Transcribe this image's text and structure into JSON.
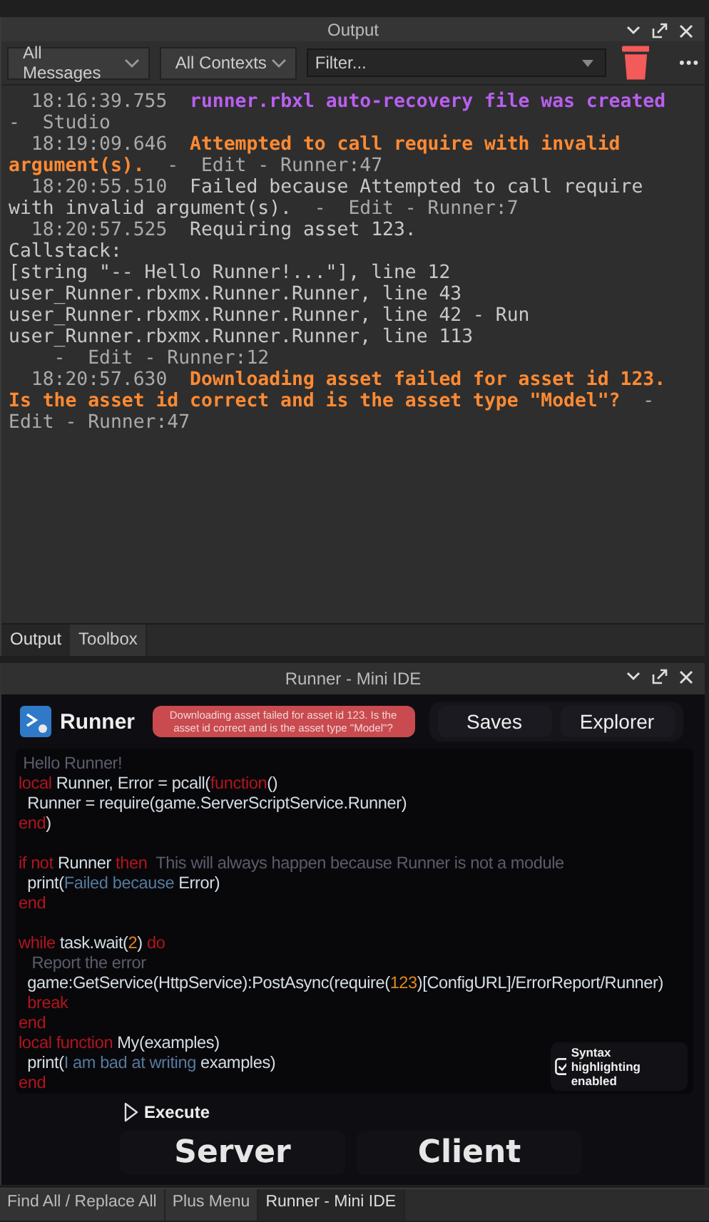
{
  "output_panel": {
    "title": "Output",
    "filters": [
      {
        "label": "All Messages"
      },
      {
        "label": "All Contexts"
      }
    ],
    "filter_field": {
      "placeholder": "Filter..."
    },
    "entries": [
      {
        "time": "18:16:39.755",
        "kind": "info",
        "message": "runner.rbxl auto-recovery file was created",
        "source": "-  Studio"
      },
      {
        "time": "18:19:09.646",
        "kind": "warning",
        "message": "Attempted to call require with invalid argument(s).",
        "source": "-  Edit - Runner:47"
      },
      {
        "time": "18:20:55.510",
        "kind": "plain",
        "message": "Failed because Attempted to call require with invalid argument(s).",
        "source": "-  Edit - Runner:7"
      },
      {
        "time": "18:20:57.525",
        "kind": "plain",
        "message": "Requiring asset 123.\nCallstack:\n[string \"-- Hello Runner!...\"], line 12\nuser_Runner.rbxmx.Runner.Runner, line 43\nuser_Runner.rbxmx.Runner.Runner, line 42 - Run\nuser_Runner.rbxmx.Runner.Runner, line 113\n",
        "source": "  -  Edit - Runner:12"
      },
      {
        "time": "18:20:57.630",
        "kind": "warning",
        "message": "Downloading asset failed for asset id 123. Is the asset id correct and is the asset type \"Model\"?",
        "source": "-  Edit - Runner:47"
      }
    ],
    "tabs": [
      {
        "label": "Output",
        "selected": true
      },
      {
        "label": "Toolbox",
        "selected": false
      }
    ]
  },
  "ide_panel": {
    "title": "Runner - Mini IDE",
    "app_name": "Runner",
    "error_badge": "Downloading asset failed for asset id 123.  Is the asset id correct and is the asset type \"Model\"?",
    "header_buttons": [
      {
        "label": "Saves"
      },
      {
        "label": "Explorer"
      }
    ],
    "code_lines": [
      {
        "kind": "code",
        "tokens": [
          {
            "t": " Hello Runner!",
            "kind": "comment"
          }
        ]
      },
      {
        "kind": "code",
        "tokens": [
          {
            "t": "local ",
            "kind": "keyword"
          },
          {
            "t": "Runner, Error = pcall(",
            "kind": "text"
          },
          {
            "t": "function",
            "kind": "keyword"
          },
          {
            "t": "()",
            "kind": "text"
          }
        ]
      },
      {
        "kind": "code",
        "tokens": [
          {
            "t": "  Runner = require(game.ServerScriptService.Runner)",
            "kind": "text"
          }
        ]
      },
      {
        "kind": "code",
        "tokens": [
          {
            "t": "end",
            "kind": "keyword"
          },
          {
            "t": ")",
            "kind": "text"
          }
        ]
      },
      {
        "kind": "blank"
      },
      {
        "kind": "code",
        "tokens": [
          {
            "t": "if not ",
            "kind": "keyword"
          },
          {
            "t": "Runner ",
            "kind": "text"
          },
          {
            "t": "then ",
            "kind": "keyword"
          },
          {
            "t": " This will always happen because Runner is not a module",
            "kind": "comment"
          }
        ]
      },
      {
        "kind": "code",
        "tokens": [
          {
            "t": "  print(",
            "kind": "text"
          },
          {
            "t": "Failed because ",
            "kind": "string"
          },
          {
            "t": "Error)",
            "kind": "text"
          }
        ]
      },
      {
        "kind": "code",
        "tokens": [
          {
            "t": "end",
            "kind": "keyword"
          }
        ]
      },
      {
        "kind": "blank"
      },
      {
        "kind": "code",
        "tokens": [
          {
            "t": "while ",
            "kind": "keyword"
          },
          {
            "t": "task.wait(",
            "kind": "text"
          },
          {
            "t": "2",
            "kind": "number"
          },
          {
            "t": ") ",
            "kind": "text"
          },
          {
            "t": "do",
            "kind": "keyword"
          }
        ]
      },
      {
        "kind": "code",
        "tokens": [
          {
            "t": "   Report the error",
            "kind": "comment"
          }
        ]
      },
      {
        "kind": "code",
        "tokens": [
          {
            "t": "  game:GetService(HttpService):PostAsync(require(",
            "kind": "text"
          },
          {
            "t": "123",
            "kind": "number"
          },
          {
            "t": ")[ConfigURL]/ErrorReport/Runner)",
            "kind": "text"
          }
        ]
      },
      {
        "kind": "code",
        "tokens": [
          {
            "t": "  break",
            "kind": "keyword"
          }
        ]
      },
      {
        "kind": "code",
        "tokens": [
          {
            "t": "end",
            "kind": "keyword"
          }
        ]
      },
      {
        "kind": "code",
        "tokens": [
          {
            "t": "local function ",
            "kind": "keyword"
          },
          {
            "t": "My(examples)",
            "kind": "text"
          }
        ]
      },
      {
        "kind": "code",
        "tokens": [
          {
            "t": "  print(",
            "kind": "text"
          },
          {
            "t": "I am bad at writing ",
            "kind": "string"
          },
          {
            "t": "examples)",
            "kind": "text"
          }
        ]
      },
      {
        "kind": "code",
        "tokens": [
          {
            "t": "end",
            "kind": "keyword"
          }
        ]
      }
    ],
    "syntax_toggle": {
      "label": "Syntax highlighting enabled",
      "checked": true
    },
    "execute_label": "Execute",
    "run_buttons": [
      {
        "label": "Server"
      },
      {
        "label": "Client"
      }
    ]
  },
  "bottom_tabs": [
    {
      "label": "Find All / Replace All",
      "selected": false
    },
    {
      "label": "Plus Menu",
      "selected": false
    },
    {
      "label": "Runner - Mini IDE",
      "selected": true
    }
  ]
}
